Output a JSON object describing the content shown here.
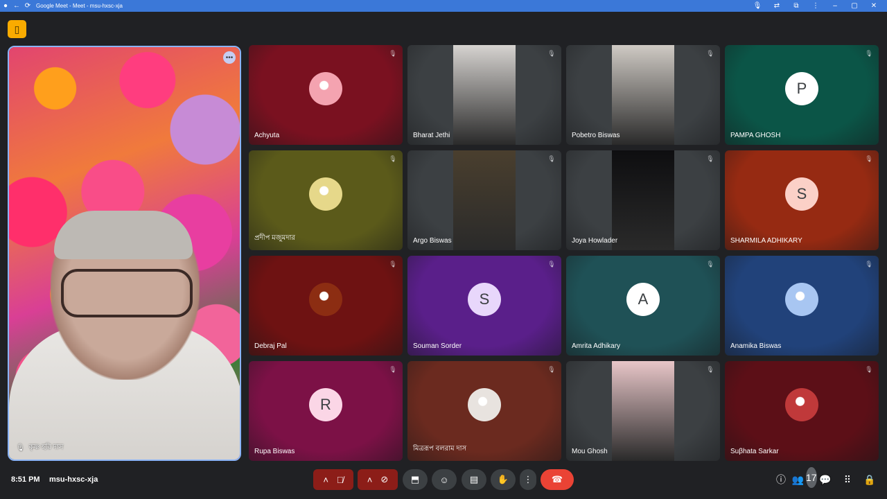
{
  "browser": {
    "title": "Google Meet - Meet - msu-hxsc-xja"
  },
  "self": {
    "name": "কৃষ্ণ হরি দাস"
  },
  "participants": [
    {
      "name": "Achyuta",
      "bg": "#7a1120",
      "avatar_type": "image",
      "avatar_color": "#f4a3b0",
      "muted": true
    },
    {
      "name": "Bharat Jethi",
      "bg": "#3c4043",
      "avatar_type": "camera",
      "cam_color": "#d6d3d0",
      "muted": true
    },
    {
      "name": "Pobetro Biswas",
      "bg": "#3c4043",
      "avatar_type": "camera",
      "cam_color": "#cfcac4",
      "muted": true
    },
    {
      "name": "PAMPA GHOSH",
      "bg": "#0b5547",
      "avatar_type": "letter",
      "letter": "P",
      "avatar_color": "#ffffff",
      "muted": true
    },
    {
      "name": "প্রদীপ মজুমদার",
      "bg": "#5b5a1a",
      "avatar_type": "image",
      "avatar_color": "#e6d88a",
      "muted": true
    },
    {
      "name": "Argo Biswas",
      "bg": "#3c4043",
      "avatar_type": "camera",
      "cam_color": "#4a3f2e",
      "muted": true
    },
    {
      "name": "Joya Howlader",
      "bg": "#3c4043",
      "avatar_type": "camera",
      "cam_color": "#0e0e10",
      "muted": true
    },
    {
      "name": "SHARMILA ADHIKARY",
      "bg": "#962a12",
      "avatar_type": "letter",
      "letter": "S",
      "avatar_color": "#fbd0c7",
      "muted": true
    },
    {
      "name": "Debraj Pal",
      "bg": "#6e1212",
      "avatar_type": "image",
      "avatar_color": "#8c2d12",
      "muted": true
    },
    {
      "name": "Souman Sorder",
      "bg": "#5a1f8a",
      "avatar_type": "letter",
      "letter": "S",
      "avatar_color": "#e8d7fb",
      "muted": true
    },
    {
      "name": "Amrita Adhikary",
      "bg": "#1f5156",
      "avatar_type": "letter",
      "letter": "A",
      "avatar_color": "#ffffff",
      "muted": true
    },
    {
      "name": "Anamika Biswas",
      "bg": "#21427a",
      "avatar_type": "image",
      "avatar_color": "#a8c6f2",
      "muted": true
    },
    {
      "name": "Rupa Biswas",
      "bg": "#7c1146",
      "avatar_type": "letter",
      "letter": "R",
      "avatar_color": "#fbd6e6",
      "muted": true
    },
    {
      "name": "মিত্ররূপ বলরাম দাস",
      "bg": "#6b2a1f",
      "avatar_type": "image",
      "avatar_color": "#e8e3df",
      "muted": true
    },
    {
      "name": "Mou Ghosh",
      "bg": "#3c4043",
      "avatar_type": "camera",
      "cam_color": "#e8c6c8",
      "muted": true
    },
    {
      "name": "Suβhata Sarkar",
      "bg": "#5c0f17",
      "avatar_type": "image",
      "avatar_color": "#c0393a",
      "muted": true
    }
  ],
  "bottom": {
    "time": "8:51 PM",
    "meeting_code": "msu-hxsc-xja",
    "people_count": "17"
  }
}
